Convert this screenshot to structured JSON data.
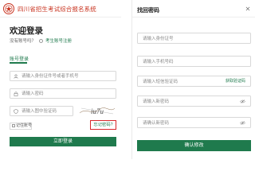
{
  "header": {
    "site_title": "四川省招生考试综合报名系统",
    "logo_icon": "provincial-seal-logo"
  },
  "login": {
    "welcome": "欢迎登录",
    "no_account": "没有账号吗？",
    "register_link": "考生账号注册",
    "tab_account": "账号登录",
    "id_placeholder": "请输入身份证件号或者手机号",
    "password_placeholder": "请输入密码",
    "captcha_placeholder": "请输入图中验证码",
    "captcha_text": "iu7u",
    "remember": "记住账号",
    "forgot": "忘记密码?",
    "submit": "立即登录",
    "icons": {
      "user": "user-icon",
      "lock": "lock-icon",
      "shield": "shield-icon",
      "question": "question-icon"
    }
  },
  "reset": {
    "title": "找回密码",
    "id_placeholder": "请输入身份证号",
    "phone_placeholder": "请输入手机号码",
    "sms_placeholder": "请输入短信验证码",
    "get_code": "获取验证码",
    "new_password_placeholder": "请输入新密码",
    "confirm_password_placeholder": "请确认新密码",
    "submit": "确认修改",
    "icons": {
      "close": "close-icon",
      "eye": "eye-slash-icon"
    }
  },
  "colors": {
    "brand_green": "#1f7a4d",
    "brand_red": "#c8331f",
    "highlight_red": "#d8282a"
  }
}
